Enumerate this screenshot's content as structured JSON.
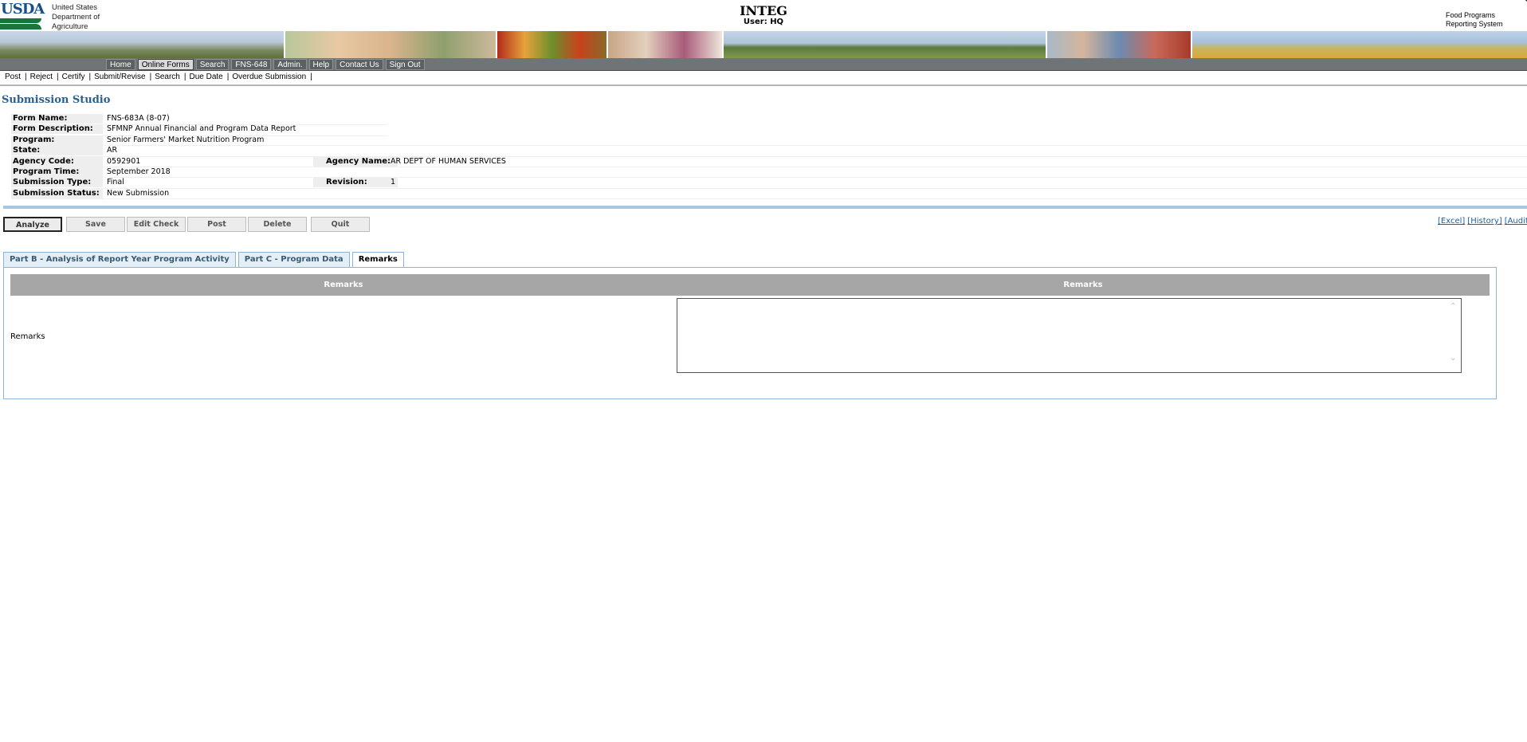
{
  "header": {
    "logo_text": "USDA",
    "department_lines": [
      "United States",
      "Department of",
      "Agriculture"
    ],
    "app_title": "INTEG",
    "user_label": "User: HQ",
    "system_lines": [
      "Food Programs",
      "Reporting System"
    ]
  },
  "nav": {
    "items": [
      "Home",
      "Online Forms",
      "Search",
      "FNS-648",
      "Admin.",
      "Help",
      "Contact Us",
      "Sign Out"
    ],
    "active": "Online Forms"
  },
  "subnav": {
    "items": [
      "Post",
      "Reject",
      "Certify",
      "Submit/Revise",
      "Search",
      "Due Date",
      "Overdue Submission"
    ],
    "separator": "|"
  },
  "page_title": "Submission Studio",
  "info": {
    "form_name_label": "Form Name:",
    "form_name": "FNS-683A (8-07)",
    "form_description_label": "Form Description:",
    "form_description": "SFMNP Annual Financial and Program Data Report",
    "program_label": "Program:",
    "program": "Senior Farmers' Market Nutrition Program",
    "state_label": "State:",
    "state": "AR",
    "agency_code_label": "Agency Code:",
    "agency_code": "0592901",
    "agency_name_label": "Agency Name:",
    "agency_name": "AR DEPT OF HUMAN SERVICES",
    "program_time_label": "Program Time:",
    "program_time": "September 2018",
    "submission_type_label": "Submission Type:",
    "submission_type": "Final",
    "revision_label": "Revision:",
    "revision": "1",
    "submission_status_label": "Submission Status:",
    "submission_status": "New Submission"
  },
  "actions": {
    "analyze": "Analyze",
    "save": "Save",
    "edit_check": "Edit Check",
    "post": "Post",
    "delete": "Delete",
    "quit": "Quit"
  },
  "links": {
    "excel": "[Excel]",
    "history": "[History]",
    "audit": "[Audit]"
  },
  "tabs": [
    {
      "label": "Part B - Analysis of Report Year Program Activity"
    },
    {
      "label": "Part C - Program Data"
    },
    {
      "label": "Remarks"
    }
  ],
  "remarks_table": {
    "col1_header": "Remarks",
    "col2_header": "Remarks",
    "row_label": "Remarks",
    "value": ""
  },
  "colors": {
    "nav_bg": "#6f7476",
    "title_blue": "#2b5f8c",
    "link_blue": "#1f5da8",
    "tab_border": "#8fb3d6",
    "header_gray": "#a6a6a6",
    "usda_green": "#16763c"
  }
}
